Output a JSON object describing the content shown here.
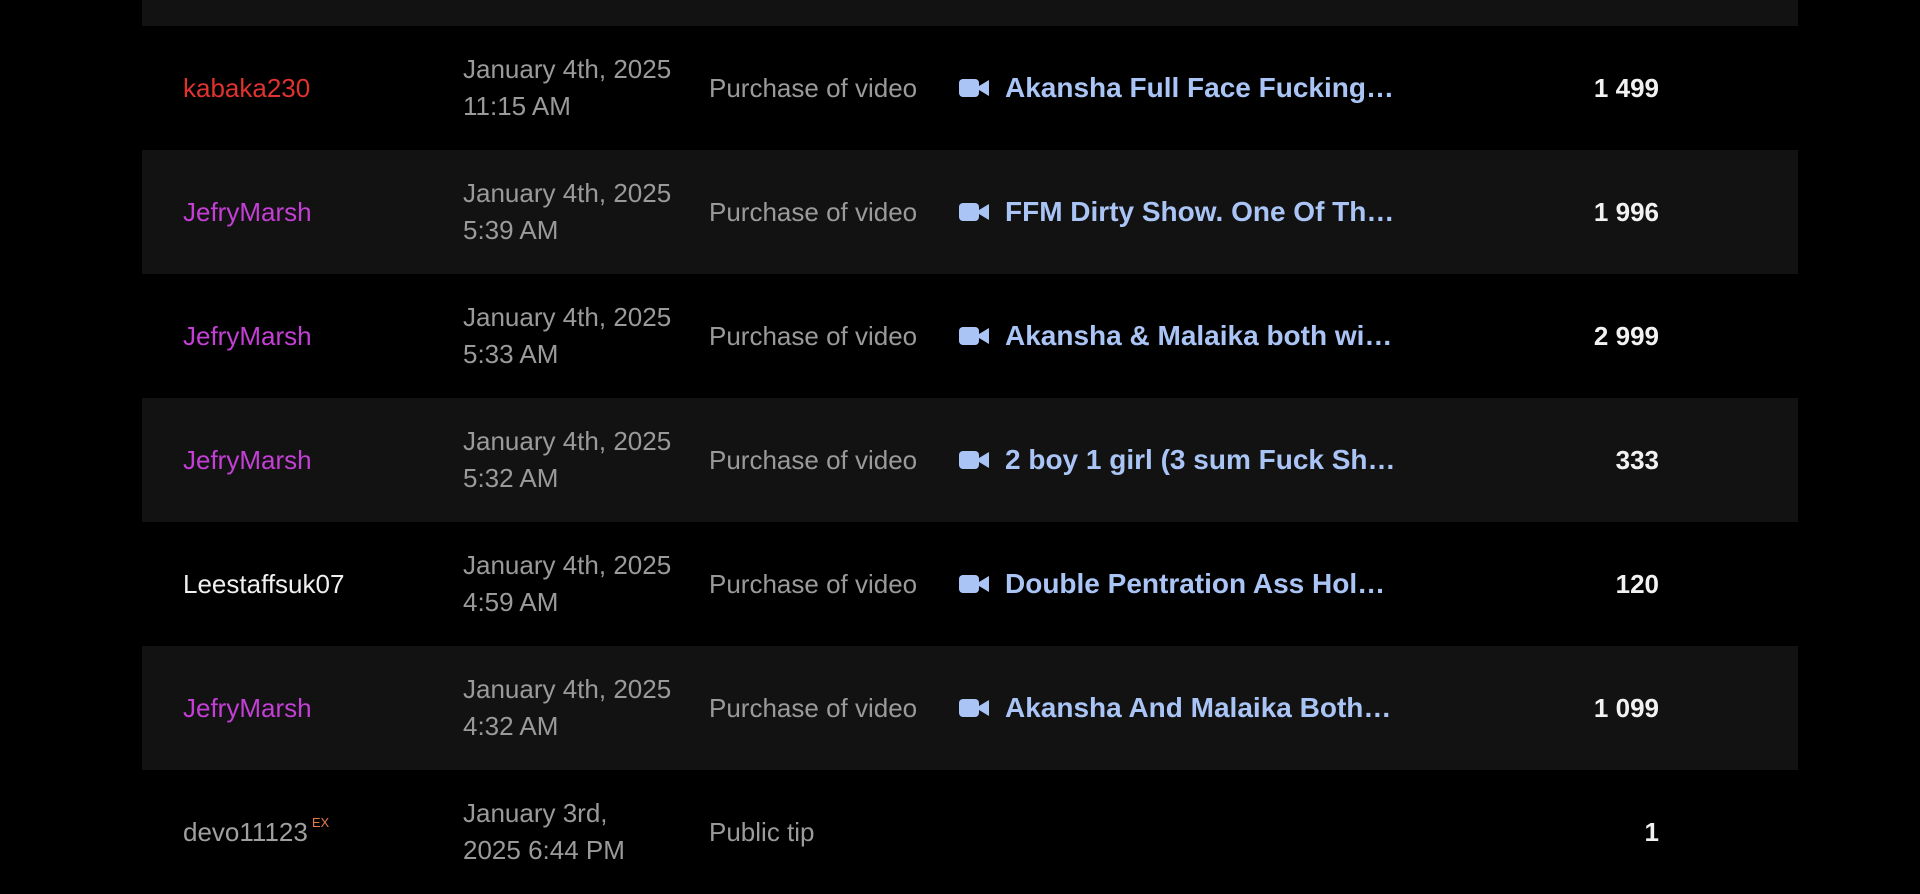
{
  "colors": {
    "background": "#000000",
    "row_alt": "#121212",
    "username_red": "#e0322e",
    "username_purple": "#c43fd6",
    "username_white": "#f0f0f0",
    "username_gray": "#a0a0a0",
    "item_link": "#a9c4f5",
    "muted_text": "#9a9a9a",
    "amount": "#f2f2f2",
    "ex_badge": "#e07a4a"
  },
  "transactions": [
    {
      "user": "kabaka230",
      "user_color": "red",
      "date_line1": "January 4th, 2025",
      "date_line2": "11:15 AM",
      "type": "Purchase of video",
      "item_icon": "video-camera-icon",
      "item_title": "Akansha Full Face Fucking…",
      "amount": "1 499"
    },
    {
      "user": "JefryMarsh",
      "user_color": "purple",
      "date_line1": "January 4th, 2025",
      "date_line2": "5:39 AM",
      "type": "Purchase of video",
      "item_icon": "video-camera-icon",
      "item_title": "FFM Dirty Show. One Of Th…",
      "amount": "1 996"
    },
    {
      "user": "JefryMarsh",
      "user_color": "purple",
      "date_line1": "January 4th, 2025",
      "date_line2": "5:33 AM",
      "type": "Purchase of video",
      "item_icon": "video-camera-icon",
      "item_title": "Akansha & Malaika both wi…",
      "amount": "2 999"
    },
    {
      "user": "JefryMarsh",
      "user_color": "purple",
      "date_line1": "January 4th, 2025",
      "date_line2": "5:32 AM",
      "type": "Purchase of video",
      "item_icon": "video-camera-icon",
      "item_title": "2 boy 1 girl (3 sum Fuck Sh…",
      "amount": "333"
    },
    {
      "user": "Leestaffsuk07",
      "user_color": "white",
      "date_line1": "January 4th, 2025",
      "date_line2": "4:59 AM",
      "type": "Purchase of video",
      "item_icon": "video-camera-icon",
      "item_title": "Double Pentration Ass Hol…",
      "amount": "120"
    },
    {
      "user": "JefryMarsh",
      "user_color": "purple",
      "date_line1": "January 4th, 2025",
      "date_line2": "4:32 AM",
      "type": "Purchase of video",
      "item_icon": "video-camera-icon",
      "item_title": "Akansha And Malaika Both…",
      "amount": "1 099"
    },
    {
      "user": "devo11123",
      "user_color": "gray",
      "user_badge": "EX",
      "date_line1": "January 3rd,",
      "date_line2": "2025 6:44 PM",
      "type": "Public tip",
      "amount": "1"
    }
  ]
}
